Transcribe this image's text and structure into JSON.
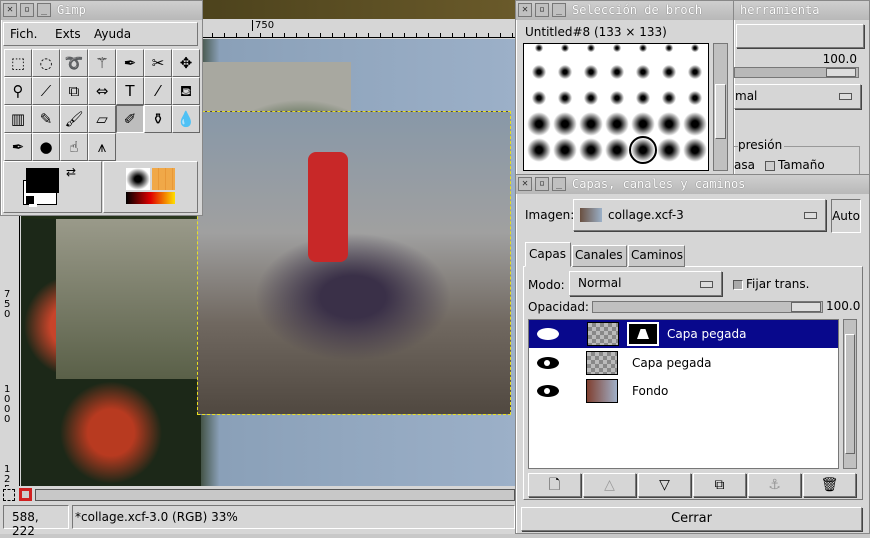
{
  "image_window": {
    "ruler_h_label": "750",
    "ruler_v_labels": [
      "750",
      "1000",
      "125"
    ],
    "coords": "588, 222",
    "status": "*collage.xcf-3.0 (RGB) 33%"
  },
  "toolbox": {
    "title": "Gimp",
    "menu": [
      "Fich.",
      "Exts",
      "Ayuda"
    ],
    "tools": [
      {
        "icon": "rect-select-icon",
        "g": "⬚"
      },
      {
        "icon": "ellipse-select-icon",
        "g": "◌"
      },
      {
        "icon": "lasso-icon",
        "g": "➰"
      },
      {
        "icon": "magic-wand-icon",
        "g": "⚚"
      },
      {
        "icon": "bezier-select-icon",
        "g": "✒"
      },
      {
        "icon": "scissors-icon",
        "g": "✂"
      },
      {
        "icon": "move-icon",
        "g": "✥"
      },
      {
        "icon": "zoom-icon",
        "g": "⚲"
      },
      {
        "icon": "crop-icon",
        "g": "⟋"
      },
      {
        "icon": "transform-icon",
        "g": "⧉"
      },
      {
        "icon": "flip-icon",
        "g": "⇔"
      },
      {
        "icon": "text-icon",
        "g": "T"
      },
      {
        "icon": "color-picker-icon",
        "g": "⁄"
      },
      {
        "icon": "bucket-fill-icon",
        "g": "⛾"
      },
      {
        "icon": "gradient-icon",
        "g": "▥"
      },
      {
        "icon": "pencil-icon",
        "g": "✎"
      },
      {
        "icon": "paintbrush-icon",
        "g": "🖌"
      },
      {
        "icon": "eraser-icon",
        "g": "▱"
      },
      {
        "icon": "airbrush-icon",
        "g": "✐"
      },
      {
        "icon": "clone-icon",
        "g": "⚱"
      },
      {
        "icon": "blur-icon",
        "g": "💧"
      },
      {
        "icon": "ink-icon",
        "g": "✒"
      },
      {
        "icon": "dodge-icon",
        "g": "●"
      },
      {
        "icon": "smudge-icon",
        "g": "☝"
      },
      {
        "icon": "measure-icon",
        "g": "⩚"
      }
    ],
    "active_tool": 18,
    "fg": "#000000",
    "bg": "#ffffff"
  },
  "brushes": {
    "title": "Selección de broch",
    "brush_name": "Untitled#8  (133 × 133)"
  },
  "tool_options": {
    "title": "herramienta",
    "value": "100.0",
    "mode": "mal",
    "group": "presión",
    "check1": "asa",
    "check2": "Tamaño"
  },
  "layers": {
    "title": "Capas, canales y caminos",
    "image_label": "Imagen:",
    "image_value": "collage.xcf-3",
    "auto": "Auto",
    "tabs": [
      "Capas",
      "Canales",
      "Caminos"
    ],
    "mode_label": "Modo:",
    "mode": "Normal",
    "keep_trans": "Fijar trans.",
    "opacity_label": "Opacidad:",
    "opacity": "100.0",
    "rows": [
      {
        "name": "Capa pegada",
        "selected": true,
        "mask": true
      },
      {
        "name": "Capa pegada"
      },
      {
        "name": "Fondo"
      }
    ],
    "buttons": [
      {
        "icon": "new-layer-icon",
        "g": "🗋"
      },
      {
        "icon": "raise-layer-icon",
        "g": "△"
      },
      {
        "icon": "lower-layer-icon",
        "g": "▽"
      },
      {
        "icon": "duplicate-layer-icon",
        "g": "⧉"
      },
      {
        "icon": "anchor-icon",
        "g": "⚓"
      },
      {
        "icon": "trash-icon",
        "g": "🗑"
      }
    ],
    "close": "Cerrar",
    "accent": "#08088c"
  }
}
